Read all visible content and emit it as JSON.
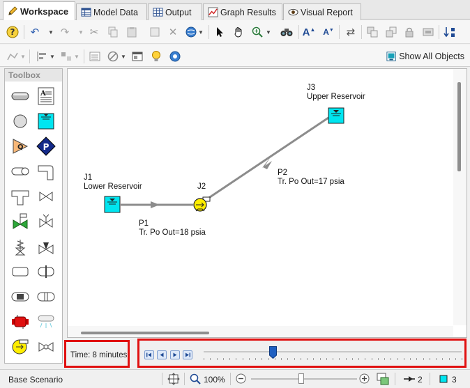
{
  "tabs": [
    {
      "label": "Workspace",
      "active": true
    },
    {
      "label": "Model Data",
      "active": false
    },
    {
      "label": "Output",
      "active": false
    },
    {
      "label": "Graph Results",
      "active": false
    },
    {
      "label": "Visual Report",
      "active": false
    }
  ],
  "toolbar": {
    "show_all_objects": "Show All Objects"
  },
  "toolbox": {
    "title": "Toolbox",
    "tools": [
      "pipe-tool",
      "annotation-tool",
      "junction-tool",
      "reservoir-tool",
      "assigned-flow-tool",
      "assigned-pressure-tool",
      "branch-tool",
      "bend-tool",
      "tee-tool",
      "valve-tool",
      "control-valve-tool",
      "check-valve-tool",
      "relief-valve-tool",
      "three-way-valve-tool",
      "area-change-tool",
      "orifice-tool",
      "screen-tool",
      "heat-exchanger-tool",
      "spray-discharge-tool",
      "pump-tool",
      "volume-balance-tool"
    ]
  },
  "model": {
    "nodes": {
      "j1": {
        "id": "J1",
        "name": "Lower Reservoir"
      },
      "j2": {
        "id": "J2"
      },
      "j3": {
        "id": "J3",
        "name": "Upper Reservoir"
      }
    },
    "pipes": {
      "p1": {
        "id": "P1",
        "result": "Tr. Po Out=18 psia"
      },
      "p2": {
        "id": "P2",
        "result": "Tr. Po Out=17 psia"
      }
    },
    "colors": {
      "reservoir": "#00e5f0",
      "pump": "#ffee00",
      "pipe": "#8c8c8c"
    }
  },
  "animation": {
    "time_label": "Time: 8 minutes",
    "slider_fraction": 0.27
  },
  "status": {
    "scenario": "Base Scenario",
    "zoom": "100%",
    "pipe_count": "2",
    "junction_count": "3"
  }
}
